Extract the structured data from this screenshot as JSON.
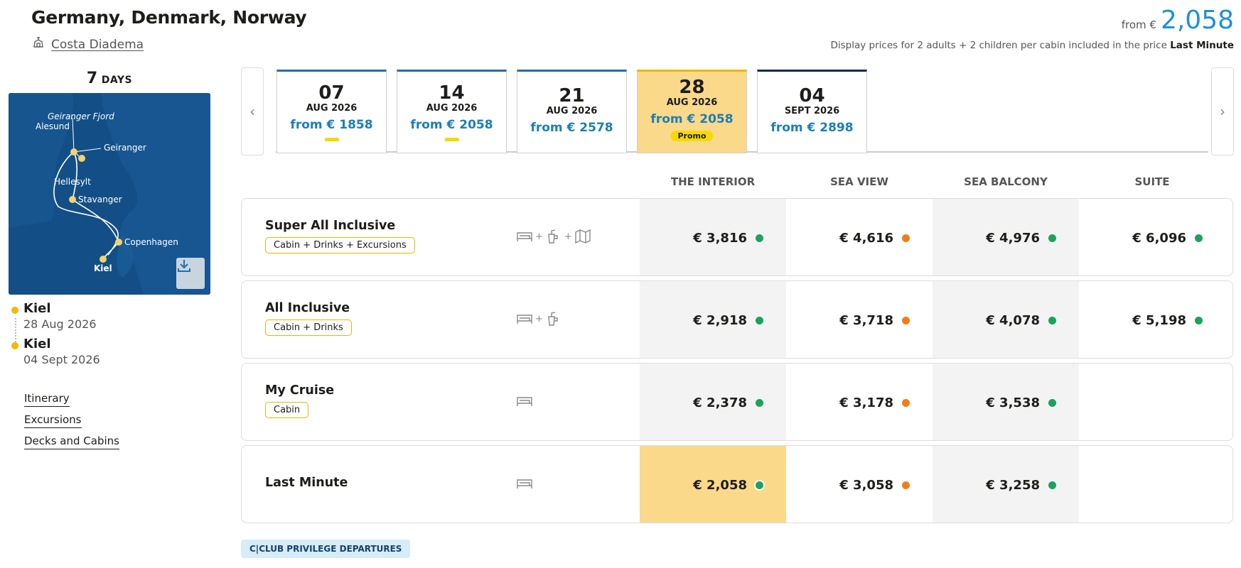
{
  "header": {
    "title": "Germany, Denmark, Norway",
    "ship": "Costa Diadema",
    "from_label": "from €",
    "from_value": "2,058",
    "display_note": "Display prices for 2 adults + 2 children per cabin included in the price",
    "display_note_bold": "Last Minute"
  },
  "itinerary": {
    "days_num": "7",
    "days_unit": "DAYS",
    "map_labels": [
      "Geiranger Fjord",
      "Alesund",
      "Geiranger",
      "Hellesylt",
      "Stavanger",
      "Copenhagen",
      "Kiel"
    ],
    "ports": [
      {
        "name": "Kiel",
        "date": "28 Aug 2026"
      },
      {
        "name": "Kiel",
        "date": "04 Sept 2026"
      }
    ],
    "links": [
      "Itinerary",
      "Excursions",
      "Decks and Cabins"
    ]
  },
  "dates": [
    {
      "day": "07",
      "month": "AUG 2026",
      "price": "from € 1858",
      "marker": "bar"
    },
    {
      "day": "14",
      "month": "AUG 2026",
      "price": "from € 2058",
      "marker": "bar"
    },
    {
      "day": "21",
      "month": "AUG 2026",
      "price": "from € 2578",
      "marker": ""
    },
    {
      "day": "28",
      "month": "AUG 2026",
      "price": "from € 2058",
      "marker": "promo",
      "promo": "Promo",
      "selected": true
    },
    {
      "day": "04",
      "month": "SEPT 2026",
      "price": "from € 2898",
      "marker": ""
    }
  ],
  "columns": [
    "THE INTERIOR",
    "SEA VIEW",
    "SEA BALCONY",
    "SUITE"
  ],
  "rows": [
    {
      "name": "Super All Inclusive",
      "chip": "Cabin + Drinks + Excursions",
      "icons": "bed-drinks-map",
      "prices": [
        "€ 3,816",
        "€ 4,616",
        "€ 4,976",
        "€ 6,096"
      ],
      "dots": [
        "green",
        "orange",
        "green",
        "green"
      ]
    },
    {
      "name": "All Inclusive",
      "chip": "Cabin + Drinks",
      "icons": "bed-drinks",
      "prices": [
        "€ 2,918",
        "€ 3,718",
        "€ 4,078",
        "€ 5,198"
      ],
      "dots": [
        "green",
        "orange",
        "green",
        "green"
      ]
    },
    {
      "name": "My Cruise",
      "chip": "Cabin",
      "icons": "bed",
      "prices": [
        "€ 2,378",
        "€ 3,178",
        "€ 3,538",
        ""
      ],
      "dots": [
        "green",
        "orange",
        "green",
        ""
      ]
    },
    {
      "name": "Last Minute",
      "chip": "",
      "icons": "bed",
      "prices": [
        "€ 2,058",
        "€ 3,058",
        "€ 3,258",
        ""
      ],
      "dots": [
        "green",
        "orange",
        "green",
        ""
      ]
    }
  ],
  "colors": {
    "accent": "#1e90d8",
    "highlight": "#fbd98a",
    "green": "#1aa35a",
    "orange": "#f57c14",
    "chip_border": "#f0b400"
  },
  "club_label": "C|CLUB PRIVILEGE DEPARTURES"
}
